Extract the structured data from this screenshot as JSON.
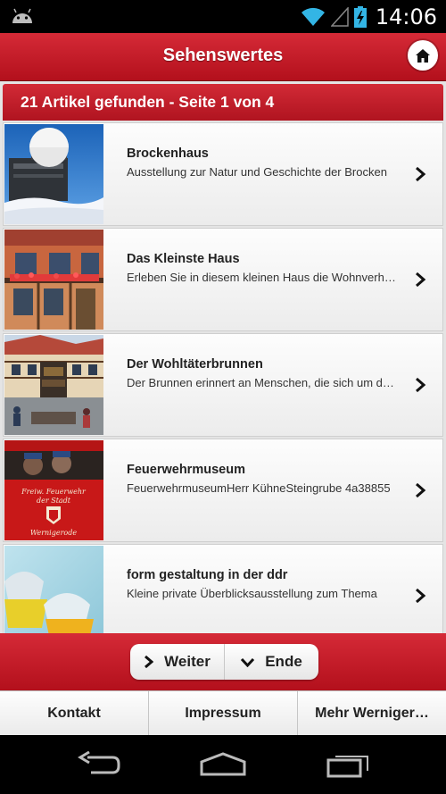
{
  "status_bar": {
    "time": "14:06",
    "icons": [
      "android-icon",
      "wifi-icon",
      "signal-icon",
      "battery-charging-icon"
    ]
  },
  "header": {
    "title": "Sehenswertes",
    "home_icon": "home-icon"
  },
  "results": {
    "summary": "21 Artikel gefunden - Seite 1 von 4"
  },
  "items": [
    {
      "title": "Brockenhaus",
      "description": "Ausstellung zur Natur und Geschichte der Brocken",
      "thumb": "brockenhaus-thumbnail"
    },
    {
      "title": "Das Kleinste Haus",
      "description": "Erleben Sie in diesem kleinen Haus die Wohnverhältnisse",
      "thumb": "kleinste-haus-thumbnail"
    },
    {
      "title": "Der Wohltäterbrunnen",
      "description": "Der Brunnen erinnert an Menschen, die sich um die Stadt",
      "thumb": "wohltaeterbrunnen-thumbnail"
    },
    {
      "title": "Feuerwehrmuseum",
      "description": "FeuerwehrmuseumHerr KühneSteingrube 4a38855",
      "thumb": "feuerwehrmuseum-thumbnail",
      "thumb_text": [
        "Freiw. Feuerwehr",
        "der Stadt",
        "Wernigerode"
      ]
    },
    {
      "title": "form gestaltung in der ddr",
      "description": "Kleine private Überblicksausstellung zum Thema",
      "thumb": "form-gestaltung-thumbnail"
    }
  ],
  "pagination": {
    "next_label": "Weiter",
    "end_label": "Ende"
  },
  "nav": {
    "contact": "Kontakt",
    "imprint": "Impressum",
    "more": "Mehr Werniger…"
  },
  "colors": {
    "brand_red": "#c41e2b",
    "header_red_dark": "#b3101c",
    "list_bg": "#e4e4e4"
  }
}
